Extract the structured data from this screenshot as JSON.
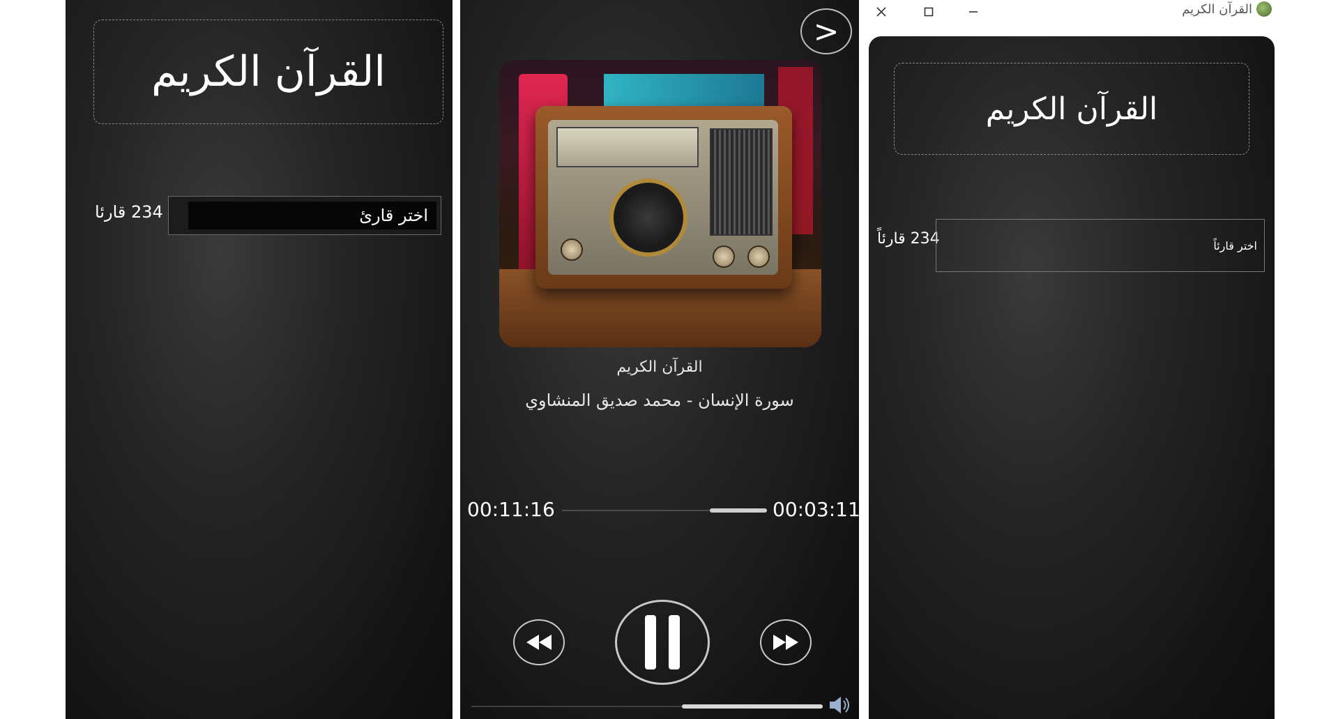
{
  "left_panel": {
    "title": "القرآن الكريم",
    "reciter_count": "234 قارئا",
    "reciter_select_placeholder": "اختر قارئ"
  },
  "player": {
    "next_button_label": ">",
    "album_art": "vintage-radio-image",
    "track_title": "القرآن الكريم",
    "track_subtitle": "سورة الإنسان - محمد صديق المنشاوي",
    "time_total": "00:11:16",
    "time_elapsed": "00:03:11",
    "progress_fraction": 0.28,
    "volume_fraction": 0.4,
    "controls": {
      "rewind_icon": "rewind-icon",
      "pause_icon": "pause-icon",
      "forward_icon": "fast-forward-icon",
      "volume_icon": "speaker-icon"
    }
  },
  "window": {
    "title": "القرآن الكريم",
    "controls": [
      "close-icon",
      "maximize-icon",
      "minimize-icon"
    ],
    "heading": "القرآن الكريم",
    "reciter_count": "234 قارئاً",
    "reciter_select_placeholder": "اختر قارئاً"
  },
  "colors": {
    "background_dark": "#1a1a1a",
    "text": "#ffffff",
    "dashed_border": "#8a8a8a"
  }
}
